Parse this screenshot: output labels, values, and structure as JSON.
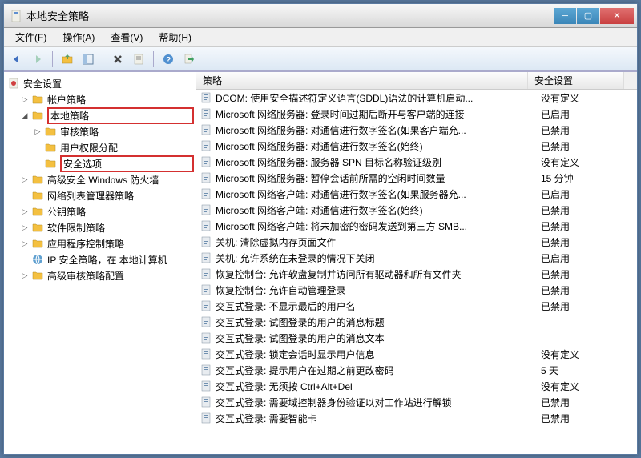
{
  "window": {
    "title": "本地安全策略"
  },
  "menu": {
    "file": "文件(F)",
    "action": "操作(A)",
    "view": "查看(V)",
    "help": "帮助(H)"
  },
  "tree": {
    "root": "安全设置",
    "items": [
      {
        "label": "帐户策略",
        "indent": 1,
        "expand": "▷",
        "hl": false
      },
      {
        "label": "本地策略",
        "indent": 1,
        "expand": "◢",
        "hl": true
      },
      {
        "label": "审核策略",
        "indent": 2,
        "expand": "▷",
        "hl": false
      },
      {
        "label": "用户权限分配",
        "indent": 2,
        "expand": "",
        "hl": false
      },
      {
        "label": "安全选项",
        "indent": 2,
        "expand": "",
        "hl": true
      },
      {
        "label": "高级安全 Windows 防火墙",
        "indent": 1,
        "expand": "▷",
        "hl": false
      },
      {
        "label": "网络列表管理器策略",
        "indent": 1,
        "expand": "",
        "hl": false
      },
      {
        "label": "公钥策略",
        "indent": 1,
        "expand": "▷",
        "hl": false
      },
      {
        "label": "软件限制策略",
        "indent": 1,
        "expand": "▷",
        "hl": false
      },
      {
        "label": "应用程序控制策略",
        "indent": 1,
        "expand": "▷",
        "hl": false
      },
      {
        "label": "IP 安全策略，在 本地计算机",
        "indent": 1,
        "expand": "",
        "hl": false,
        "icon": "ip"
      },
      {
        "label": "高级审核策略配置",
        "indent": 1,
        "expand": "▷",
        "hl": false
      }
    ]
  },
  "list": {
    "col_policy": "策略",
    "col_setting": "安全设置",
    "rows": [
      {
        "p": "DCOM: 使用安全描述符定义语言(SDDL)语法的计算机启动...",
        "s": "没有定义"
      },
      {
        "p": "Microsoft 网络服务器: 登录时间过期后断开与客户端的连接",
        "s": "已启用"
      },
      {
        "p": "Microsoft 网络服务器: 对通信进行数字签名(如果客户端允...",
        "s": "已禁用"
      },
      {
        "p": "Microsoft 网络服务器: 对通信进行数字签名(始终)",
        "s": "已禁用"
      },
      {
        "p": "Microsoft 网络服务器: 服务器 SPN 目标名称验证级别",
        "s": "没有定义"
      },
      {
        "p": "Microsoft 网络服务器: 暂停会话前所需的空闲时间数量",
        "s": "15 分钟"
      },
      {
        "p": "Microsoft 网络客户端: 对通信进行数字签名(如果服务器允...",
        "s": "已启用"
      },
      {
        "p": "Microsoft 网络客户端: 对通信进行数字签名(始终)",
        "s": "已禁用"
      },
      {
        "p": "Microsoft 网络客户端: 将未加密的密码发送到第三方 SMB...",
        "s": "已禁用"
      },
      {
        "p": "关机: 清除虚拟内存页面文件",
        "s": "已禁用"
      },
      {
        "p": "关机: 允许系统在未登录的情况下关闭",
        "s": "已启用"
      },
      {
        "p": "恢复控制台: 允许软盘复制并访问所有驱动器和所有文件夹",
        "s": "已禁用"
      },
      {
        "p": "恢复控制台: 允许自动管理登录",
        "s": "已禁用"
      },
      {
        "p": "交互式登录: 不显示最后的用户名",
        "s": "已禁用"
      },
      {
        "p": "交互式登录: 试图登录的用户的消息标题",
        "s": ""
      },
      {
        "p": "交互式登录: 试图登录的用户的消息文本",
        "s": ""
      },
      {
        "p": "交互式登录: 锁定会话时显示用户信息",
        "s": "没有定义"
      },
      {
        "p": "交互式登录: 提示用户在过期之前更改密码",
        "s": "5 天"
      },
      {
        "p": "交互式登录: 无须按 Ctrl+Alt+Del",
        "s": "没有定义"
      },
      {
        "p": "交互式登录: 需要域控制器身份验证以对工作站进行解锁",
        "s": "已禁用"
      },
      {
        "p": "交互式登录: 需要智能卡",
        "s": "已禁用"
      }
    ]
  }
}
